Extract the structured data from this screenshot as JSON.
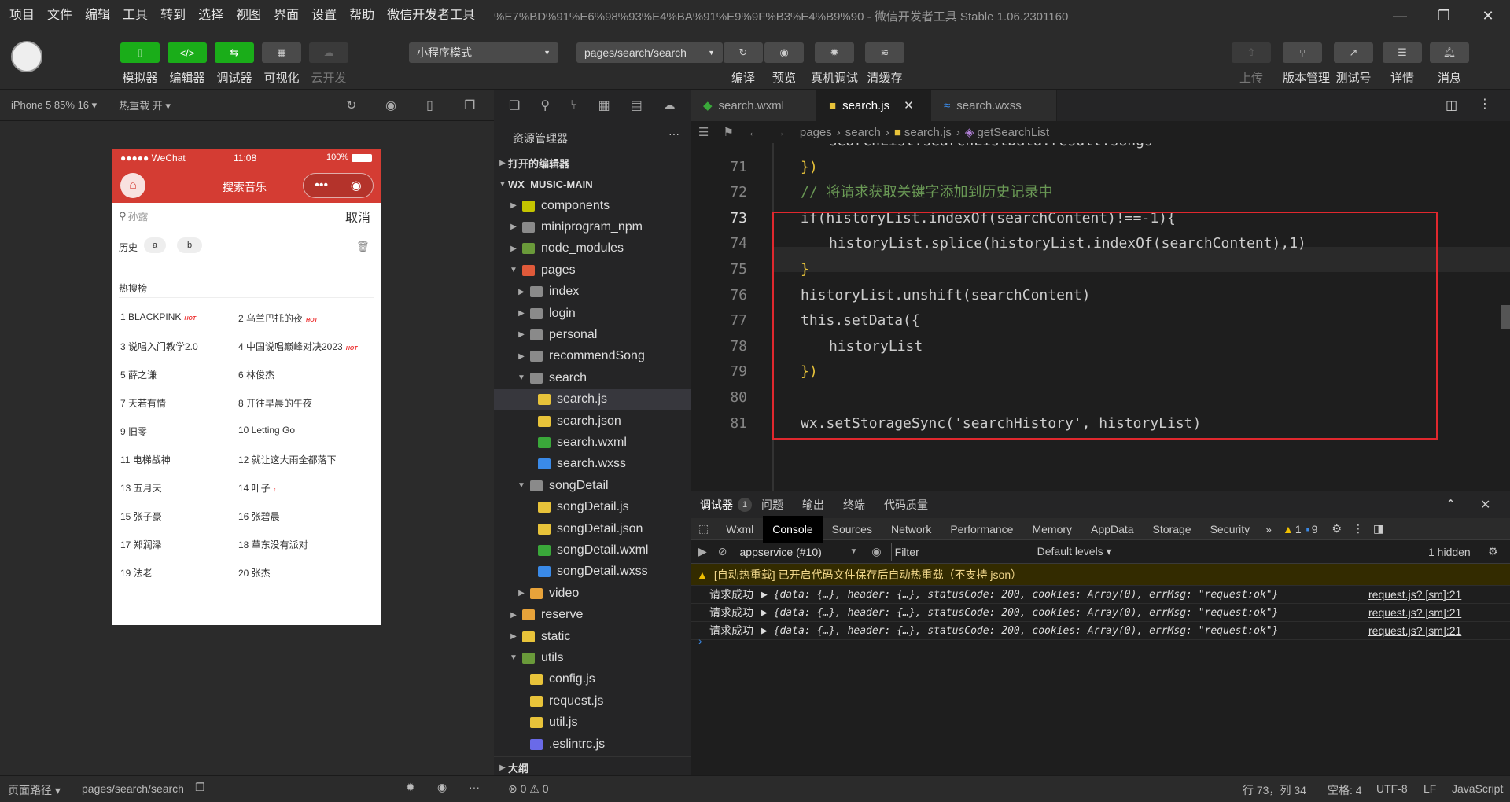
{
  "menubar": {
    "items": [
      "项目",
      "文件",
      "编辑",
      "工具",
      "转到",
      "选择",
      "视图",
      "界面",
      "设置",
      "帮助",
      "微信开发者工具"
    ],
    "title": "%E7%BD%91%E6%98%93%E4%BA%91%E9%9F%B3%E4%B9%90 - 微信开发者工具 Stable 1.06.2301160"
  },
  "toolbar": {
    "simulator": "模拟器",
    "editor": "编辑器",
    "debugger": "调试器",
    "visual": "可视化",
    "cloud": "云开发",
    "mode": "小程序模式",
    "page": "pages/search/search",
    "compile": "编译",
    "preview": "预览",
    "realdebug": "真机调试",
    "clearcache": "清缓存",
    "upload": "上传",
    "version": "版本管理",
    "test": "测试号",
    "detail": "详情",
    "message": "消息"
  },
  "simbar": {
    "device": "iPhone 5 85% 16 ▾",
    "hotreload": "热重载 开 ▾"
  },
  "phone": {
    "carrier": "●●●●● WeChat",
    "time": "11:08",
    "battery": "100%",
    "title": "搜索音乐",
    "search_placeholder": "孙露",
    "cancel": "取消",
    "history_label": "历史",
    "history": [
      "a",
      "b"
    ],
    "hot_title": "热搜榜",
    "hot_list": [
      {
        "n": "1 BLACKPINK",
        "hot": "HOT"
      },
      {
        "n": "2 乌兰巴托的夜",
        "hot": "HOT"
      },
      {
        "n": "3 说唱入门教学2.0",
        "hot": ""
      },
      {
        "n": "4 中国说唱巅峰对决2023",
        "hot": "HOT"
      },
      {
        "n": "5 薛之谦",
        "hot": ""
      },
      {
        "n": "6 林俊杰",
        "hot": ""
      },
      {
        "n": "7 天若有情",
        "hot": ""
      },
      {
        "n": "8 开往早晨的午夜",
        "hot": ""
      },
      {
        "n": "9 旧零",
        "hot": ""
      },
      {
        "n": "10 Letting Go",
        "hot": ""
      },
      {
        "n": "11 电梯战神",
        "hot": ""
      },
      {
        "n": "12 就让这大雨全都落下",
        "hot": ""
      },
      {
        "n": "13 五月天",
        "hot": ""
      },
      {
        "n": "14 叶子",
        "hot": "↑"
      },
      {
        "n": "15 张子豪",
        "hot": ""
      },
      {
        "n": "16 张碧晨",
        "hot": ""
      },
      {
        "n": "17 郑润泽",
        "hot": ""
      },
      {
        "n": "18 草东没有派对",
        "hot": ""
      },
      {
        "n": "19 法老",
        "hot": ""
      },
      {
        "n": "20 张杰",
        "hot": ""
      }
    ]
  },
  "explorer": {
    "title": "资源管理器",
    "open_editors": "打开的编辑器",
    "root": "WX_MUSIC-MAIN",
    "rows": [
      {
        "t": "components",
        "d": 1,
        "a": "▶",
        "c": "#c5c500"
      },
      {
        "t": "miniprogram_npm",
        "d": 1,
        "a": "▶",
        "c": "#8a8a8a"
      },
      {
        "t": "node_modules",
        "d": 1,
        "a": "▶",
        "c": "#6a9a3a"
      },
      {
        "t": "pages",
        "d": 1,
        "a": "▼",
        "c": "#e05a3a"
      },
      {
        "t": "index",
        "d": 2,
        "a": "▶",
        "c": "#8a8a8a"
      },
      {
        "t": "login",
        "d": 2,
        "a": "▶",
        "c": "#8a8a8a"
      },
      {
        "t": "personal",
        "d": 2,
        "a": "▶",
        "c": "#8a8a8a"
      },
      {
        "t": "recommendSong",
        "d": 2,
        "a": "▶",
        "c": "#8a8a8a"
      },
      {
        "t": "search",
        "d": 2,
        "a": "▼",
        "c": "#8a8a8a"
      },
      {
        "t": "search.js",
        "d": 3,
        "a": "",
        "c": "#e8c33a"
      },
      {
        "t": "search.json",
        "d": 3,
        "a": "",
        "c": "#e8c33a"
      },
      {
        "t": "search.wxml",
        "d": 3,
        "a": "",
        "c": "#3aa83a"
      },
      {
        "t": "search.wxss",
        "d": 3,
        "a": "",
        "c": "#3a8ae8"
      },
      {
        "t": "songDetail",
        "d": 2,
        "a": "▼",
        "c": "#8a8a8a"
      },
      {
        "t": "songDetail.js",
        "d": 3,
        "a": "",
        "c": "#e8c33a"
      },
      {
        "t": "songDetail.json",
        "d": 3,
        "a": "",
        "c": "#e8c33a"
      },
      {
        "t": "songDetail.wxml",
        "d": 3,
        "a": "",
        "c": "#3aa83a"
      },
      {
        "t": "songDetail.wxss",
        "d": 3,
        "a": "",
        "c": "#3a8ae8"
      },
      {
        "t": "video",
        "d": 2,
        "a": "▶",
        "c": "#e8a33a"
      },
      {
        "t": "reserve",
        "d": 1,
        "a": "▶",
        "c": "#e8a33a"
      },
      {
        "t": "static",
        "d": 1,
        "a": "▶",
        "c": "#e8c33a"
      },
      {
        "t": "utils",
        "d": 1,
        "a": "▼",
        "c": "#6a9a3a"
      },
      {
        "t": "config.js",
        "d": 2,
        "a": "",
        "c": "#e8c33a"
      },
      {
        "t": "request.js",
        "d": 2,
        "a": "",
        "c": "#e8c33a"
      },
      {
        "t": "util.js",
        "d": 2,
        "a": "",
        "c": "#e8c33a"
      },
      {
        "t": ".eslintrc.js",
        "d": 2,
        "a": "",
        "c": "#6a6ae8"
      }
    ],
    "outline": "大纲"
  },
  "editor": {
    "tabs": [
      "search.wxml",
      "search.js",
      "search.wxss"
    ],
    "breadcrumb": [
      "pages",
      "search",
      "search.js",
      "getSearchList"
    ],
    "lines": [
      {
        "n": "",
        "code": "searchList:searchListData.result.songs"
      },
      {
        "n": "71",
        "code": "})"
      },
      {
        "n": "72",
        "code": "// 将请求获取关键字添加到历史记录中"
      },
      {
        "n": "73",
        "code": "if(historyList.indexOf(searchContent)!==-1){"
      },
      {
        "n": "74",
        "code": "historyList.splice(historyList.indexOf(searchContent),1)"
      },
      {
        "n": "75",
        "code": "}"
      },
      {
        "n": "76",
        "code": "historyList.unshift(searchContent)"
      },
      {
        "n": "77",
        "code": "this.setData({"
      },
      {
        "n": "78",
        "code": "historyList"
      },
      {
        "n": "79",
        "code": "})"
      },
      {
        "n": "80",
        "code": ""
      },
      {
        "n": "81",
        "code": "wx.setStorageSync('searchHistory', historyList)"
      }
    ]
  },
  "devtools": {
    "top_tabs": [
      "调试器",
      "问题",
      "输出",
      "终端",
      "代码质量"
    ],
    "badge": "1",
    "tabs": [
      "Wxml",
      "Console",
      "Sources",
      "Network",
      "Performance",
      "Memory",
      "AppData",
      "Storage",
      "Security"
    ],
    "warn_count": "1",
    "msg_count": "9",
    "context": "appservice (#10)",
    "filter_placeholder": "Filter",
    "levels": "Default levels ▾",
    "hidden": "1 hidden",
    "warning": "[自动热重载] 已开启代码文件保存后自动热重载（不支持 json）",
    "logs": [
      {
        "label": "请求成功",
        "obj": "▶ {data: {…}, header: {…}, statusCode: 200, cookies: Array(0), errMsg: \"request:ok\"}",
        "src": "request.js? [sm]:21"
      },
      {
        "label": "请求成功",
        "obj": "▶ {data: {…}, header: {…}, statusCode: 200, cookies: Array(0), errMsg: \"request:ok\"}",
        "src": "request.js? [sm]:21"
      },
      {
        "label": "请求成功",
        "obj": "▶ {data: {…}, header: {…}, statusCode: 200, cookies: Array(0), errMsg: \"request:ok\"}",
        "src": "request.js? [sm]:21"
      }
    ]
  },
  "statusbar": {
    "path_label": "页面路径 ▾",
    "path": "pages/search/search",
    "errors": "⊗ 0 ⚠ 0",
    "cursor": "行 73，列 34",
    "spaces": "空格: 4",
    "encoding": "UTF-8",
    "eol": "LF",
    "lang": "JavaScript"
  }
}
